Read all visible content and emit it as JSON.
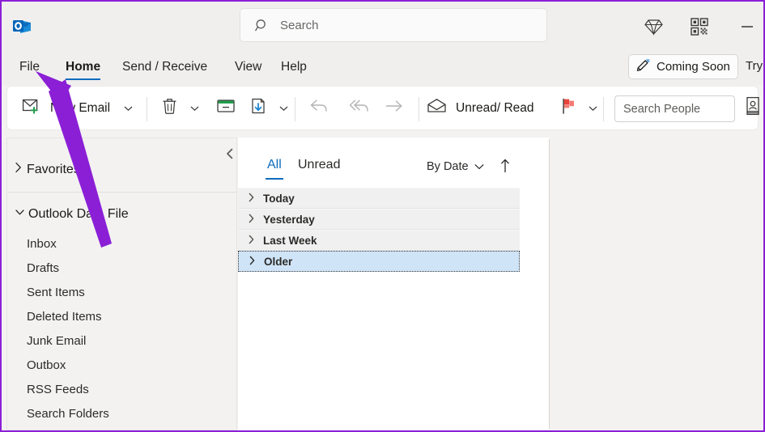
{
  "window": {
    "accent_blue": "#0f6cbd",
    "annotation_color": "#8b1fd6",
    "selection_blue": "#cfe4f7"
  },
  "titlebar": {
    "logo_icon": "outlook-logo-icon",
    "search": {
      "placeholder": "Search",
      "value": "",
      "icon": "search-icon"
    },
    "icons": [
      {
        "name": "diamond-icon",
        "label": "Diamond"
      },
      {
        "name": "qr-code-icon",
        "label": "QR Code"
      },
      {
        "name": "minimize-icon",
        "label": "Minimize"
      }
    ]
  },
  "tabs": [
    {
      "id": "file",
      "label": "File",
      "active": false
    },
    {
      "id": "home",
      "label": "Home",
      "active": true
    },
    {
      "id": "sr",
      "label": "Send / Receive",
      "active": false
    },
    {
      "id": "view",
      "label": "View",
      "active": false
    },
    {
      "id": "help",
      "label": "Help",
      "active": false
    }
  ],
  "coming_soon": {
    "label": "Coming Soon",
    "icon": "magic-pen-icon",
    "try_label": "Try"
  },
  "ribbon": {
    "new_email": {
      "label": "New Email",
      "icon": "new-email-icon",
      "caret": "chevron-down-icon"
    },
    "delete": {
      "icon": "trash-icon",
      "caret": "chevron-down-icon"
    },
    "archive": {
      "icon": "archive-icon"
    },
    "move_to": {
      "icon": "move-to-folder-icon",
      "caret": "chevron-down-icon"
    },
    "reply": {
      "icon": "reply-icon"
    },
    "reply_all": {
      "icon": "reply-all-icon"
    },
    "forward": {
      "icon": "forward-icon"
    },
    "unread_read": {
      "label": "Unread/ Read",
      "icon": "open-envelope-icon"
    },
    "flag": {
      "icon": "flag-icon",
      "caret": "chevron-down-icon"
    },
    "search_people": {
      "placeholder": "Search People",
      "value": ""
    },
    "address_book": {
      "icon": "address-book-icon"
    }
  },
  "folder_pane": {
    "collapse_icon": "chevron-left-icon",
    "favorites": {
      "label": "Favorites",
      "expand_icon": "chevron-right-icon",
      "expanded": false
    },
    "data_file": {
      "label": "Outlook Data File",
      "expand_icon": "chevron-down-icon",
      "expanded": true
    },
    "folders": [
      {
        "label": "Inbox"
      },
      {
        "label": "Drafts"
      },
      {
        "label": "Sent Items"
      },
      {
        "label": "Deleted Items"
      },
      {
        "label": "Junk Email"
      },
      {
        "label": "Outbox"
      },
      {
        "label": "RSS Feeds"
      },
      {
        "label": "Search Folders"
      }
    ]
  },
  "message_list": {
    "filters": [
      {
        "id": "all",
        "label": "All",
        "active": true
      },
      {
        "id": "unread",
        "label": "Unread",
        "active": false
      }
    ],
    "sort": {
      "label": "By Date",
      "caret": "chevron-down-icon"
    },
    "order": {
      "icon": "arrow-up-icon"
    },
    "groups": [
      {
        "label": "Today",
        "expand_icon": "chevron-right-icon",
        "selected": false
      },
      {
        "label": "Yesterday",
        "expand_icon": "chevron-right-icon",
        "selected": false
      },
      {
        "label": "Last Week",
        "expand_icon": "chevron-right-icon",
        "selected": false
      },
      {
        "label": "Older",
        "expand_icon": "chevron-right-icon",
        "selected": true
      }
    ]
  },
  "annotation": {
    "arrow_name": "purple-arrow-pointing-to-file-tab",
    "color": "#8b1fd6"
  }
}
